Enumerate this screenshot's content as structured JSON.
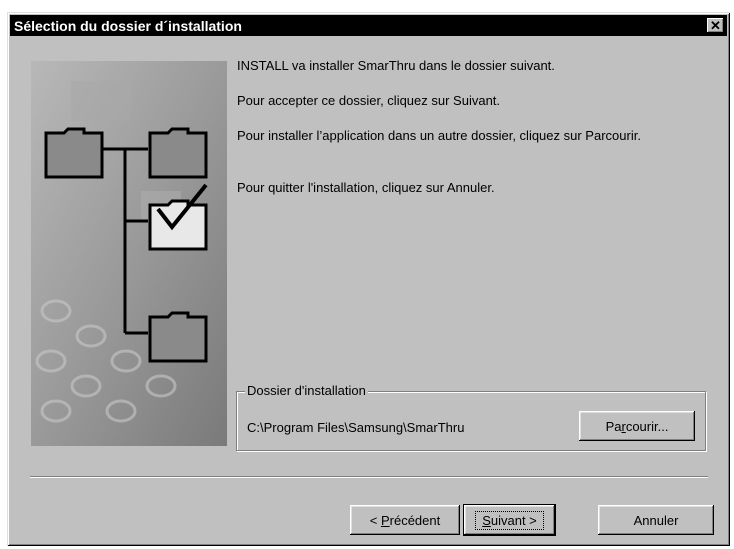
{
  "window": {
    "title": "Sélection du dossier d´installation",
    "close_glyph": "✕"
  },
  "content": {
    "paragraphs": [
      "INSTALL va installer SmarThru dans le dossier suivant.",
      "Pour accepter ce dossier, cliquez sur Suivant.",
      "Pour installer l’application dans un autre dossier, cliquez sur Parcourir.",
      "Pour quitter l'installation, cliquez sur Annuler."
    ]
  },
  "group": {
    "legend": "Dossier d'installation",
    "path": "C:\\Program Files\\Samsung\\SmarThru",
    "browse_pre": "Pa",
    "browse_mnemonic": "r",
    "browse_post": "courir..."
  },
  "buttons": {
    "back_pre": "< ",
    "back_mnemonic": "P",
    "back_post": "récédent",
    "next_mnemonic": "S",
    "next_post": "uivant >",
    "cancel": "Annuler"
  },
  "icons": {
    "art": "folder-tree-illustration",
    "close": "close-icon"
  },
  "colors": {
    "dialog_bg": "#c0c0c0",
    "titlebar_bg": "#000000",
    "titlebar_text": "#ffffff"
  }
}
